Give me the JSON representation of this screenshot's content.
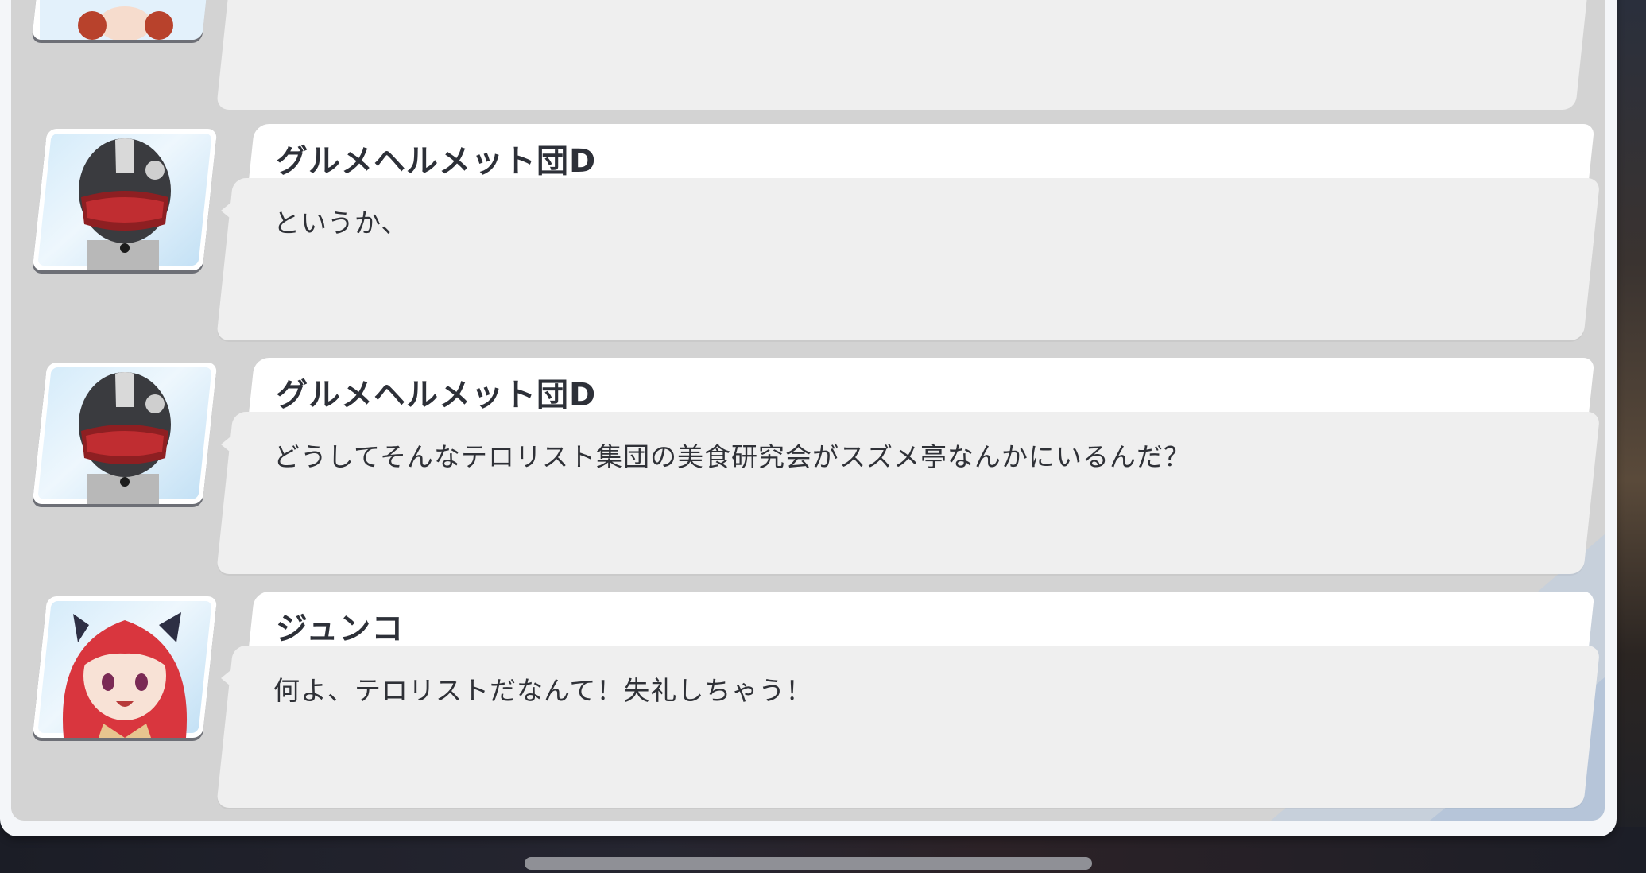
{
  "entries": [
    {
      "speaker": "グルメヘルメット団D",
      "message": "というか、",
      "avatar": "helmet-avatar"
    },
    {
      "speaker": "グルメヘルメット団D",
      "message": "どうしてそんなテロリスト集団の美食研究会がスズメ亭なんかにいるんだ？",
      "avatar": "helmet-avatar"
    },
    {
      "speaker": "ジュンコ",
      "message": "何よ、テロリストだなんて！失礼しちゃう！",
      "avatar": "junko-avatar"
    }
  ],
  "colors": {
    "panel": "#d3d3d3",
    "name_bar": "#ffffff",
    "message_box": "#efefef",
    "text": "#2f3137"
  }
}
